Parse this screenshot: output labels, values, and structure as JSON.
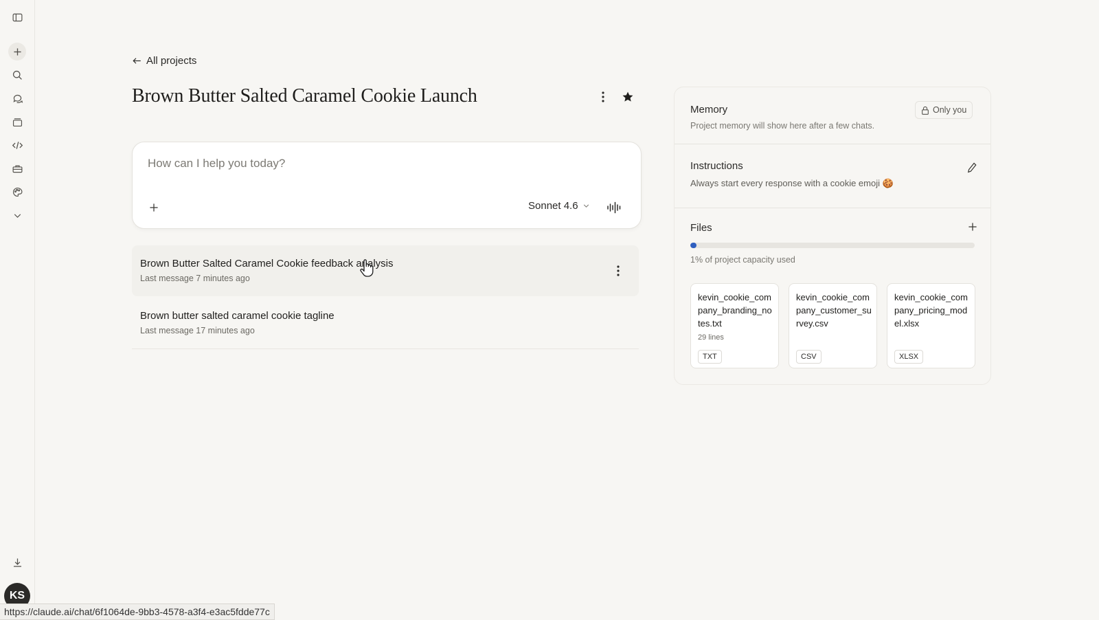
{
  "browser": {
    "status_url": "https://claude.ai/chat/6f1064de-9bb3-4578-a3f4-e3ac5fdde77c"
  },
  "rail": {
    "icons": [
      "sidebar-toggle-icon",
      "plus-icon",
      "search-icon",
      "chats-icon",
      "projects-icon",
      "code-icon",
      "toolbox-icon",
      "palette-icon",
      "chevron-down-icon",
      "download-icon"
    ],
    "avatar_initials": "KS"
  },
  "header": {
    "back_label": "All projects",
    "title": "Brown Butter Salted Caramel Cookie Launch"
  },
  "composer": {
    "placeholder": "How can I help you today?",
    "model": "Sonnet 4.6"
  },
  "chats": [
    {
      "title": "Brown Butter Salted Caramel Cookie feedback analysis",
      "meta": "Last message 7 minutes ago"
    },
    {
      "title": "Brown butter salted caramel cookie tagline",
      "meta": "Last message 17 minutes ago"
    }
  ],
  "panel": {
    "memory": {
      "title": "Memory",
      "badge": "Only you",
      "description": "Project memory will show here after a few chats."
    },
    "instructions": {
      "title": "Instructions",
      "text": "Always start every response with a cookie emoji 🍪"
    },
    "files": {
      "title": "Files",
      "capacity_text": "1% of project capacity used",
      "capacity_fraction": 0.01,
      "accent_color": "#2f5fbf",
      "items": [
        {
          "name": "kevin_cookie_company_branding_notes.txt",
          "lines": "29 lines",
          "type": "TXT"
        },
        {
          "name": "kevin_cookie_company_customer_survey.csv",
          "lines": "",
          "type": "CSV"
        },
        {
          "name": "kevin_cookie_company_pricing_model.xlsx",
          "lines": "",
          "type": "XLSX"
        }
      ]
    }
  }
}
